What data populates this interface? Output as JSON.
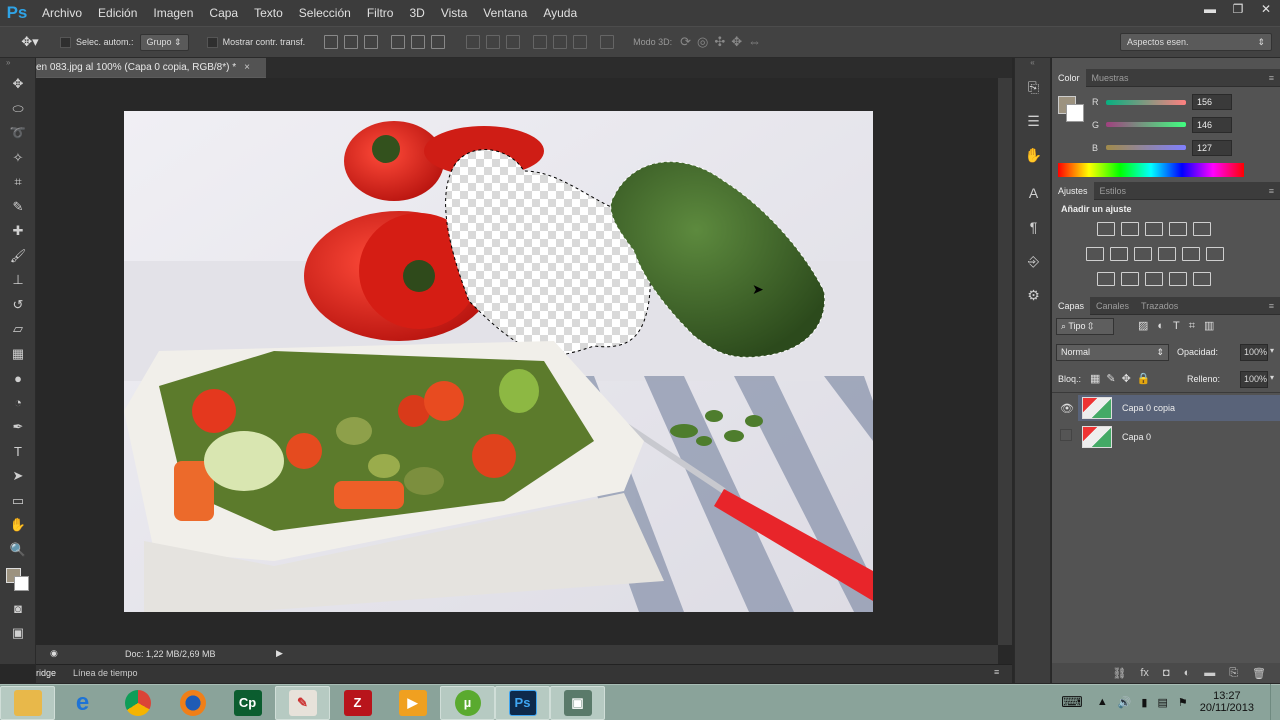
{
  "app": {
    "logo": "Ps"
  },
  "menu": [
    "Archivo",
    "Edición",
    "Imagen",
    "Capa",
    "Texto",
    "Selección",
    "Filtro",
    "3D",
    "Vista",
    "Ventana",
    "Ayuda"
  ],
  "window_controls": {
    "minimize": "▬",
    "maximize": "❐",
    "close": "✕"
  },
  "options": {
    "auto_select_label": "Selec. autom.:",
    "group_value": "Grupo",
    "transform_label": "Mostrar contr. transf.",
    "mode3d_label": "Modo 3D:",
    "workspace": "Aspectos esen."
  },
  "document": {
    "tab_title": "en 083.jpg al 100% (Capa 0 copia, RGB/8*) *",
    "tab_close": "×",
    "status": "Doc: 1,22 MB/2,69 MB"
  },
  "bottom_tabs": [
    "ridge",
    "Línea de tiempo"
  ],
  "color_panel": {
    "tabs": [
      "Color",
      "Muestras"
    ],
    "channels": [
      {
        "label": "R",
        "value": "156",
        "color": "#9c9282"
      },
      {
        "label": "G",
        "value": "146",
        "color": "#9c9282"
      },
      {
        "label": "B",
        "value": "127",
        "color": "#9c9282"
      }
    ],
    "foreground": "#9c927f"
  },
  "adjust_panel": {
    "tabs": [
      "Ajustes",
      "Estilos"
    ],
    "heading": "Añadir un ajuste"
  },
  "layers_panel": {
    "tabs": [
      "Capas",
      "Canales",
      "Trazados"
    ],
    "filter": "Tipo",
    "blend_mode": "Normal",
    "opacity_label": "Opacidad:",
    "opacity": "100%",
    "lock_label": "Bloq.:",
    "fill_label": "Relleno:",
    "fill": "100%",
    "layers": [
      {
        "name": "Capa 0 copia",
        "visible": true,
        "selected": true
      },
      {
        "name": "Capa 0",
        "visible": false,
        "selected": false
      }
    ]
  },
  "taskbar": {
    "apps": [
      "Explorador",
      "Internet Explorer",
      "Chrome",
      "Firefox",
      "Captivate",
      "Paint",
      "FileZilla",
      "Movie Maker",
      "uTorrent",
      "Photoshop",
      "Proyector"
    ],
    "time": "13:27",
    "date": "20/11/2013"
  }
}
